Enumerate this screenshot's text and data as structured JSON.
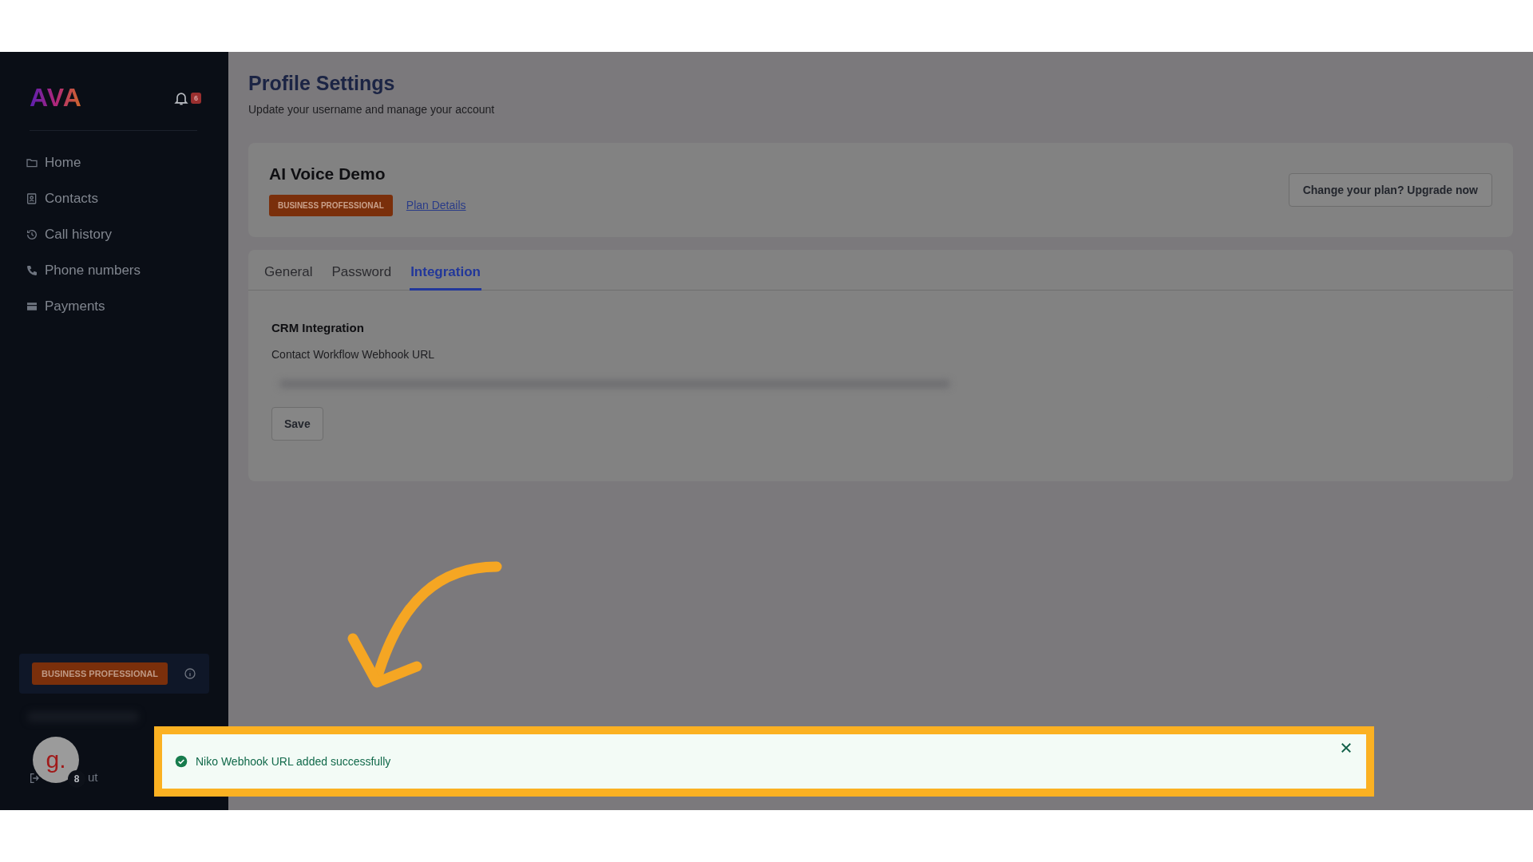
{
  "sidebar": {
    "logo": "AVA",
    "notification_count": "6",
    "nav_items": [
      {
        "label": "Home"
      },
      {
        "label": "Contacts"
      },
      {
        "label": "Call history"
      },
      {
        "label": "Phone numbers"
      },
      {
        "label": "Payments"
      }
    ],
    "plan_badge": "BUSINESS PROFESSIONAL",
    "logout_label": "ut",
    "avatar": {
      "initial": "g.",
      "badge": "8"
    }
  },
  "header": {
    "title": "Profile Settings",
    "subtitle": "Update your username and manage your account"
  },
  "account_card": {
    "name": "AI Voice Demo",
    "plan_badge": "BUSINESS PROFESSIONAL",
    "plan_link": "Plan Details",
    "upgrade_button": "Change your plan? Upgrade now"
  },
  "tabs": [
    {
      "label": "General",
      "selected": false
    },
    {
      "label": "Password",
      "selected": false
    },
    {
      "label": "Integration",
      "selected": true
    }
  ],
  "integration": {
    "heading": "CRM Integration",
    "field_label": "Contact Workflow Webhook URL",
    "save_button": "Save"
  },
  "toast": {
    "message": "Niko Webhook URL added successfully"
  }
}
